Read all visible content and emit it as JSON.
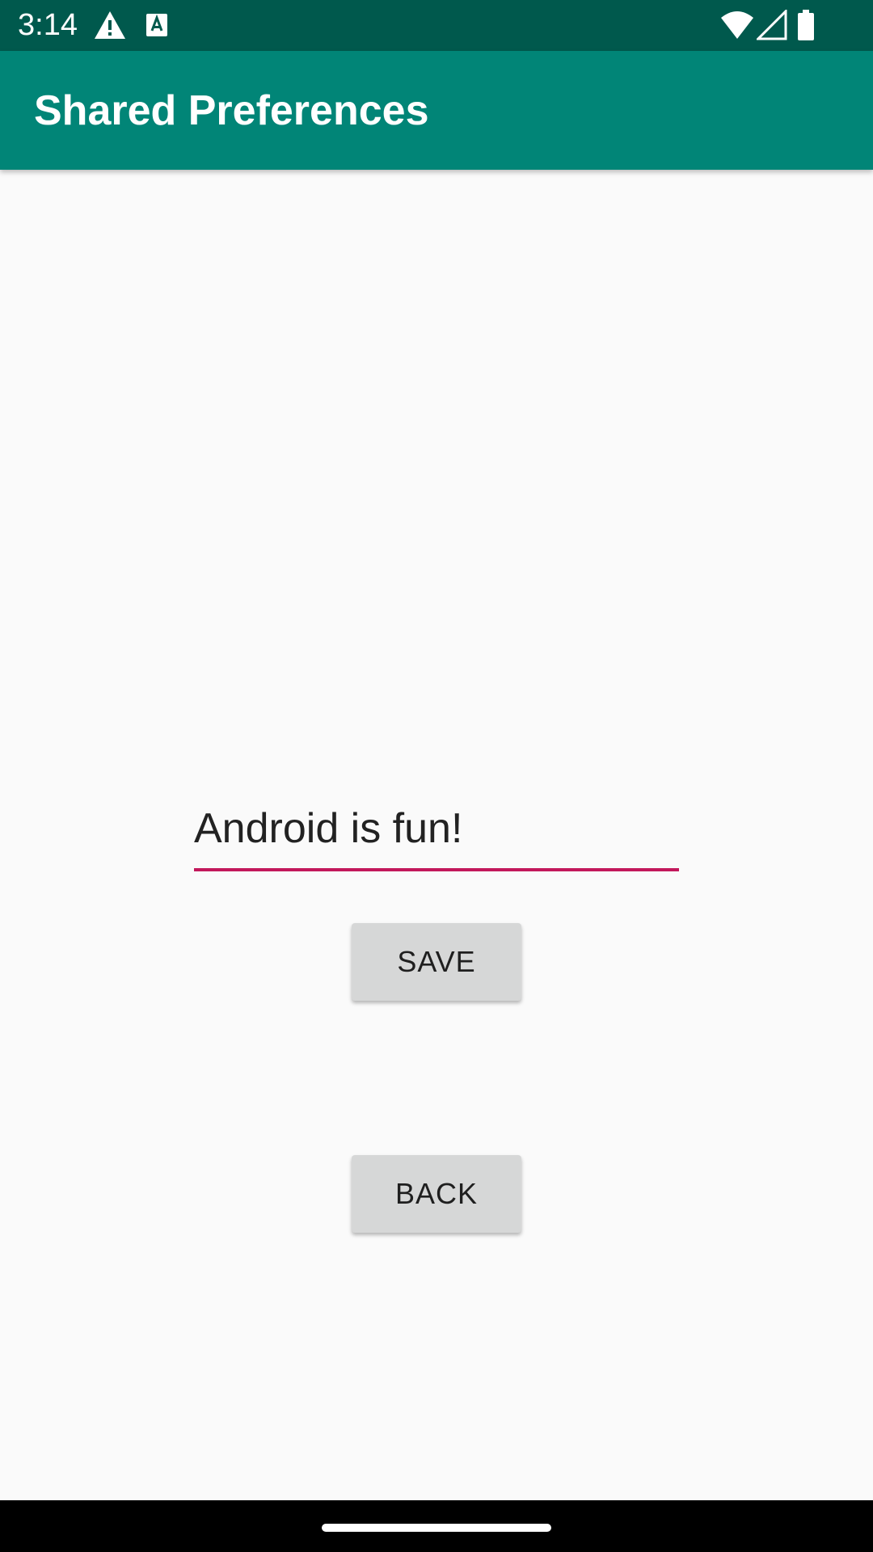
{
  "status_bar": {
    "time": "3:14",
    "icons": [
      "alert-icon",
      "a-icon",
      "wifi-icon",
      "signal-icon",
      "battery-icon"
    ],
    "background": "#00594d"
  },
  "app_bar": {
    "title": "Shared Preferences",
    "background": "#018577"
  },
  "main": {
    "input_value": "Android is fun!",
    "underline_color": "#c2185b",
    "save_label": "SAVE",
    "back_label": "BACK"
  },
  "nav_bar": {
    "handle": "home-handle"
  }
}
